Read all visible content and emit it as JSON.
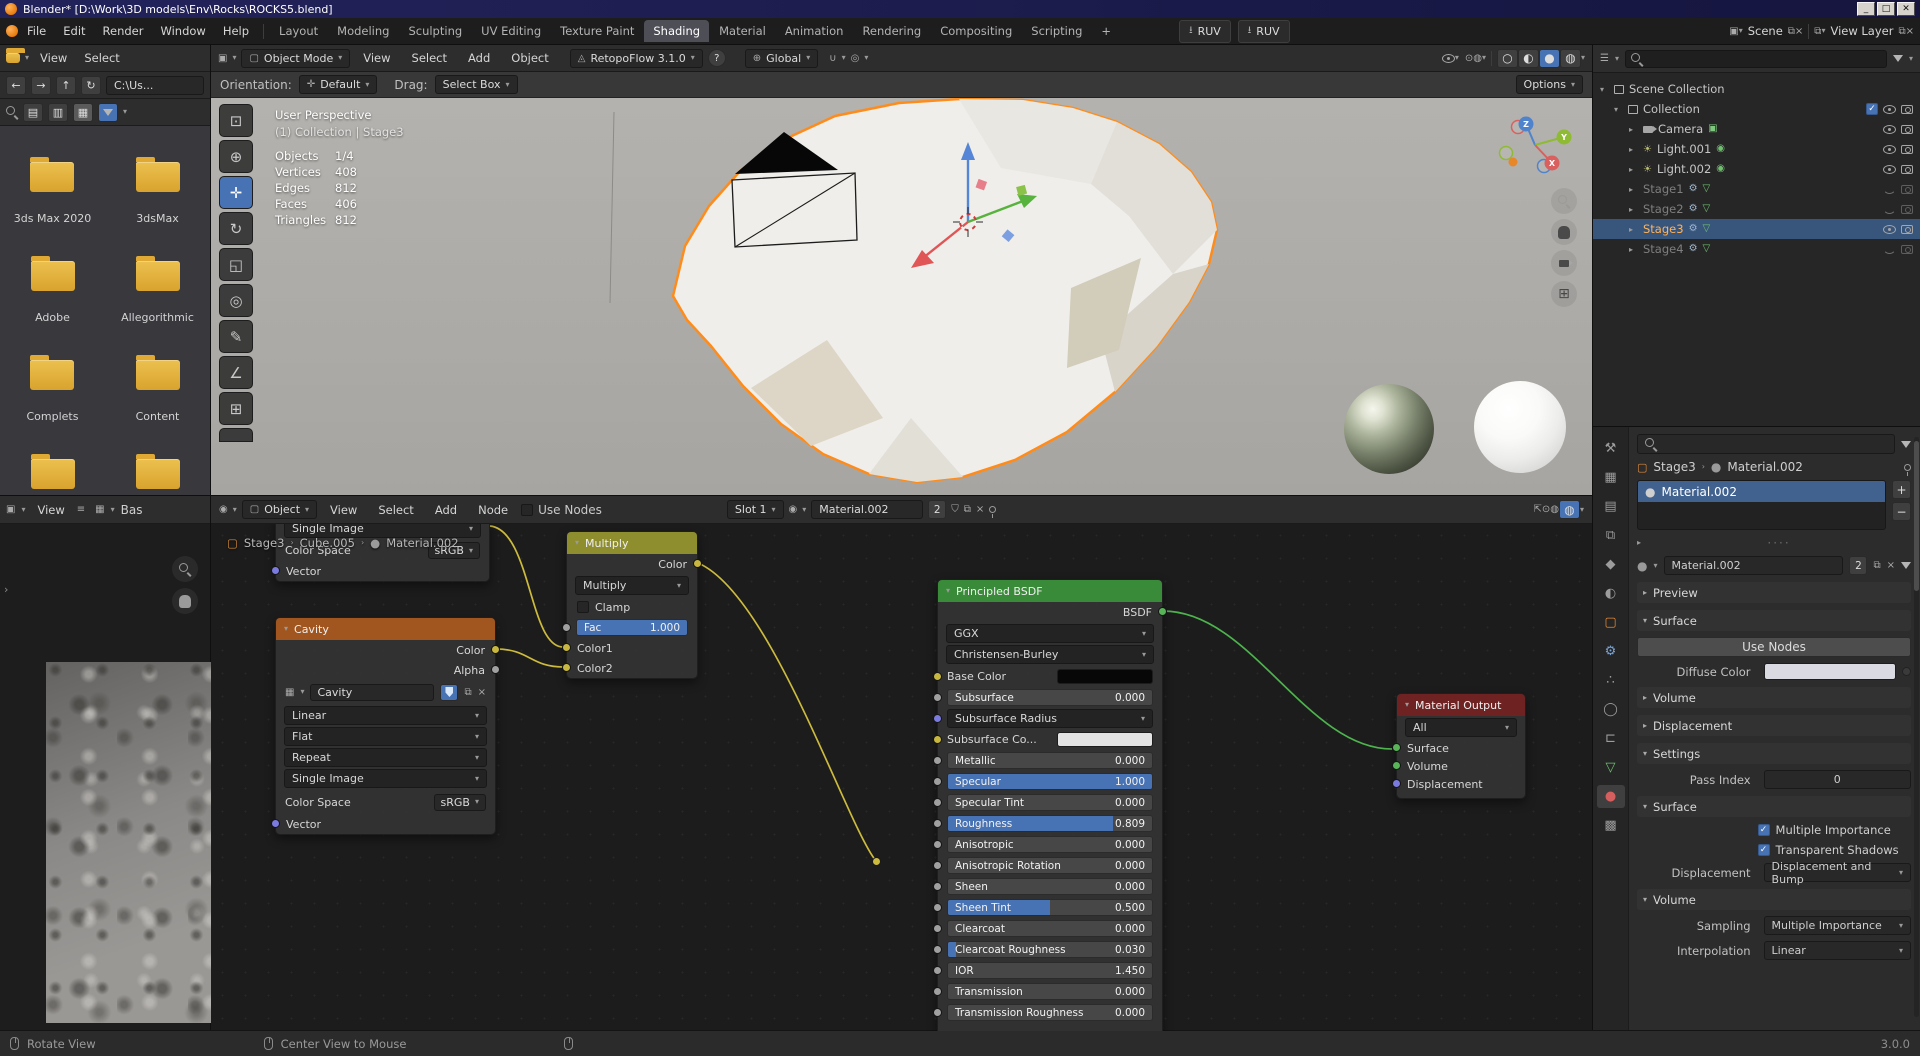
{
  "title_bar": {
    "title": "Blender* [D:\\Work\\3D models\\Env\\Rocks\\ROCKS5.blend]",
    "minimize": "_",
    "maximize": "□",
    "close": "✕"
  },
  "menu_bar": {
    "menus": [
      "File",
      "Edit",
      "Render",
      "Window",
      "Help"
    ],
    "tabs": [
      "Layout",
      "Modeling",
      "Sculpting",
      "UV Editing",
      "Texture Paint",
      "Shading",
      "Material",
      "Animation",
      "Rendering",
      "Compositing",
      "Scripting"
    ],
    "add_tab": "+",
    "addon_button_1": "RUV",
    "addon_button_2": "RUV",
    "scene_label": "Scene",
    "view_layer_label": "View Layer"
  },
  "viewport": {
    "header": {
      "mode": "Object Mode",
      "menus": [
        "View",
        "Select",
        "Add",
        "Object"
      ],
      "addon": "RetopoFlow 3.1.0",
      "help": "?",
      "orientation": "Global"
    },
    "tool_settings": {
      "orientation_label": "Orientation:",
      "orientation_value": "Default",
      "drag_label": "Drag:",
      "drag_value": "Select Box",
      "options": "Options"
    },
    "overlay": {
      "view_name": "User Perspective",
      "context": "(1) Collection | Stage3",
      "stats": [
        {
          "label": "Objects",
          "value": "1/4"
        },
        {
          "label": "Vertices",
          "value": "408"
        },
        {
          "label": "Edges",
          "value": "812"
        },
        {
          "label": "Faces",
          "value": "406"
        },
        {
          "label": "Triangles",
          "value": "812"
        }
      ]
    },
    "gizmo": {
      "x": "X",
      "y": "Y",
      "z": "Z"
    }
  },
  "file_browser": {
    "menus": [
      "View",
      "Select"
    ],
    "path": "C:\\Us...",
    "folders": [
      "3ds Max 2020",
      "3dsMax",
      "Adobe",
      "Allegorithmic",
      "Complets",
      "Content"
    ]
  },
  "image_editor": {
    "menu": "View",
    "image_name": "Bas"
  },
  "shader_editor": {
    "header": {
      "shader_type": "Object",
      "menus": [
        "View",
        "Select",
        "Add",
        "Node"
      ],
      "use_nodes": "Use Nodes",
      "slot": "Slot 1",
      "material_name": "Material.002",
      "users": "2"
    },
    "breadcrumb": {
      "object": "Stage3",
      "mesh": "Cube.005",
      "material": "Material.002"
    },
    "nodes": {
      "image_partial": {
        "source": "Single Image",
        "color_space_label": "Color Space",
        "color_space": "sRGB",
        "input": "Vector"
      },
      "cavity": {
        "title": "Cavity",
        "output_color": "Color",
        "output_alpha": "Alpha",
        "image_name": "Cavity",
        "interpolation": "Linear",
        "projection": "Flat",
        "extension": "Repeat",
        "source": "Single Image",
        "color_space_label": "Color Space",
        "color_space": "sRGB",
        "input": "Vector"
      },
      "multiply": {
        "title": "Multiply",
        "output": "Color",
        "blend_mode": "Multiply",
        "clamp": "Clamp",
        "fac_label": "Fac",
        "fac_value": "1.000",
        "fac_fill": "100%",
        "input1": "Color1",
        "input2": "Color2"
      },
      "principled": {
        "title": "Principled BSDF",
        "output": "BSDF",
        "distribution": "GGX",
        "subsurface_method": "Christensen-Burley",
        "base_color_label": "Base Color",
        "subsurface_radius_label": "Subsurface Radius",
        "subsurface_color_label": "Subsurface Co...",
        "params": [
          {
            "label": "Subsurface",
            "value": "0.000",
            "fill": "0%"
          },
          {
            "label": "Metallic",
            "value": "0.000",
            "fill": "0%"
          },
          {
            "label": "Specular",
            "value": "1.000",
            "fill": "100%"
          },
          {
            "label": "Specular Tint",
            "value": "0.000",
            "fill": "0%"
          },
          {
            "label": "Roughness",
            "value": "0.809",
            "fill": "81%"
          },
          {
            "label": "Anisotropic",
            "value": "0.000",
            "fill": "0%"
          },
          {
            "label": "Anisotropic Rotation",
            "value": "0.000",
            "fill": "0%"
          },
          {
            "label": "Sheen",
            "value": "0.000",
            "fill": "0%"
          },
          {
            "label": "Sheen Tint",
            "value": "0.500",
            "fill": "50%"
          },
          {
            "label": "Clearcoat",
            "value": "0.000",
            "fill": "0%"
          },
          {
            "label": "Clearcoat Roughness",
            "value": "0.030",
            "fill": "4%"
          },
          {
            "label": "IOR",
            "value": "1.450",
            "fill": "0%"
          },
          {
            "label": "Transmission",
            "value": "0.000",
            "fill": "0%"
          },
          {
            "label": "Transmission Roughness",
            "value": "0.000",
            "fill": "0%"
          }
        ]
      },
      "output": {
        "title": "Material Output",
        "target": "All",
        "inputs": [
          "Surface",
          "Volume",
          "Displacement"
        ]
      }
    }
  },
  "outliner": {
    "scene_collection": "Scene Collection",
    "collection": "Collection",
    "objects": [
      {
        "name": "Camera"
      },
      {
        "name": "Light.001"
      },
      {
        "name": "Light.002"
      },
      {
        "name": "Stage1"
      },
      {
        "name": "Stage2"
      },
      {
        "name": "Stage3"
      },
      {
        "name": "Stage4"
      }
    ]
  },
  "properties": {
    "breadcrumb_object": "Stage3",
    "breadcrumb_material": "Material.002",
    "slot_name": "Material.002",
    "material_name": "Material.002",
    "users": "2",
    "preview": "Preview",
    "surface": "Surface",
    "use_nodes": "Use Nodes",
    "diffuse_color": "Diffuse Color",
    "volume": "Volume",
    "displacement": "Displacement",
    "settings": "Settings",
    "pass_index_label": "Pass Index",
    "pass_index_value": "0",
    "surface_cycles": "Surface",
    "multiple_importance": "Multiple Importance",
    "transparent_shadows": "Transparent Shadows",
    "displacement_label": "Displacement",
    "displacement_value": "Displacement and Bump",
    "volume_cycles": "Volume",
    "sampling_label": "Sampling",
    "sampling_value": "Multiple Importance",
    "interpolation_label": "Interpolation",
    "interpolation_value": "Linear"
  },
  "status_bar": {
    "hint_1": "Rotate View",
    "hint_2": "Center View to Mouse",
    "version": "3.0.0"
  }
}
